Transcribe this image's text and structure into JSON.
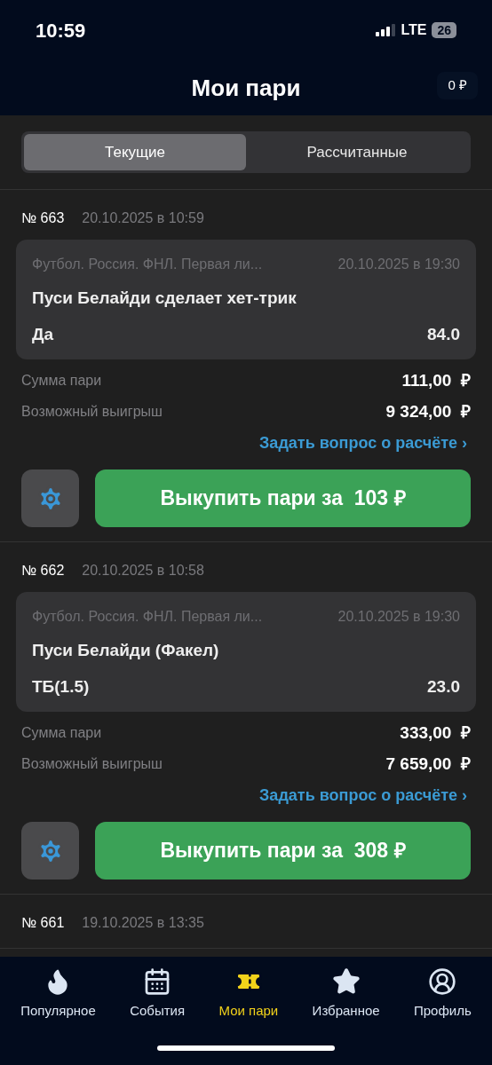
{
  "status_bar": {
    "time": "10:59",
    "network": "LTE",
    "battery": "26"
  },
  "header": {
    "title": "Мои пари",
    "balance": "0 ₽"
  },
  "tabs": [
    {
      "label": "Текущие",
      "selected": true
    },
    {
      "label": "Рассчитанные",
      "selected": false
    }
  ],
  "bets": [
    {
      "number": "№ 663",
      "placed": "20.10.2025 в 10:59",
      "event": {
        "league": "Футбол. Россия. ФНЛ. Первая ли...",
        "start": "20.10.2025 в 19:30",
        "market": "Пуси Белайди сделает хет-трик",
        "outcome": "Да",
        "odds": "84.0"
      },
      "stake_label": "Сумма пари",
      "stake": "111,00  ₽",
      "win_label": "Возможный выигрыш",
      "win": "9 324,00  ₽",
      "question_link": "Задать вопрос о расчёте ›",
      "cashout": "Выкупить пари за  103 ₽"
    },
    {
      "number": "№ 662",
      "placed": "20.10.2025 в 10:58",
      "event": {
        "league": "Футбол. Россия. ФНЛ. Первая ли...",
        "start": "20.10.2025 в 19:30",
        "market": "Пуси Белайди (Факел)",
        "outcome": "ТБ(1.5)",
        "odds": "23.0"
      },
      "stake_label": "Сумма пари",
      "stake": "333,00  ₽",
      "win_label": "Возможный выигрыш",
      "win": "7 659,00  ₽",
      "question_link": "Задать вопрос о расчёте ›",
      "cashout": "Выкупить пари за  308 ₽"
    },
    {
      "number": "№ 661",
      "placed": "19.10.2025 в 13:35"
    }
  ],
  "nav": [
    {
      "kind": "flame",
      "label": "Популярное",
      "selected": false
    },
    {
      "kind": "calendar",
      "label": "События",
      "selected": false
    },
    {
      "kind": "ticket",
      "label": "Мои пари",
      "selected": true
    },
    {
      "kind": "star",
      "label": "Избранное",
      "selected": false
    },
    {
      "kind": "profile",
      "label": "Профиль",
      "selected": false
    }
  ]
}
